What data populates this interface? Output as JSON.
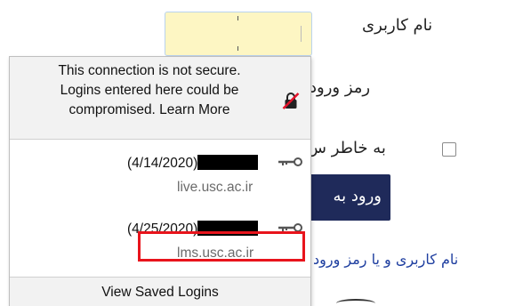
{
  "login_form": {
    "username_label": "نام کاربری",
    "password_label": "رمز ورود",
    "remember_label": "به خاطر س",
    "login_button_label": "ورود به",
    "forgot_link": "نام کاربری و یا رمز ورود"
  },
  "autocomplete_popup": {
    "warning_lines": [
      "This connection is not secure.",
      "Logins entered here could be",
      "compromised. Learn More"
    ],
    "saved_logins": [
      {
        "date": "(4/14/2020)",
        "site": "live.usc.ac.ir"
      },
      {
        "date": "(4/25/2020)",
        "site": "lms.usc.ac.ir"
      }
    ],
    "footer_label": "View Saved Logins"
  },
  "colors": {
    "autofill_background": "#fdf6c3",
    "button_background": "#1f2a5a",
    "link": "#1f3fa0",
    "highlight": "#e8141c"
  }
}
